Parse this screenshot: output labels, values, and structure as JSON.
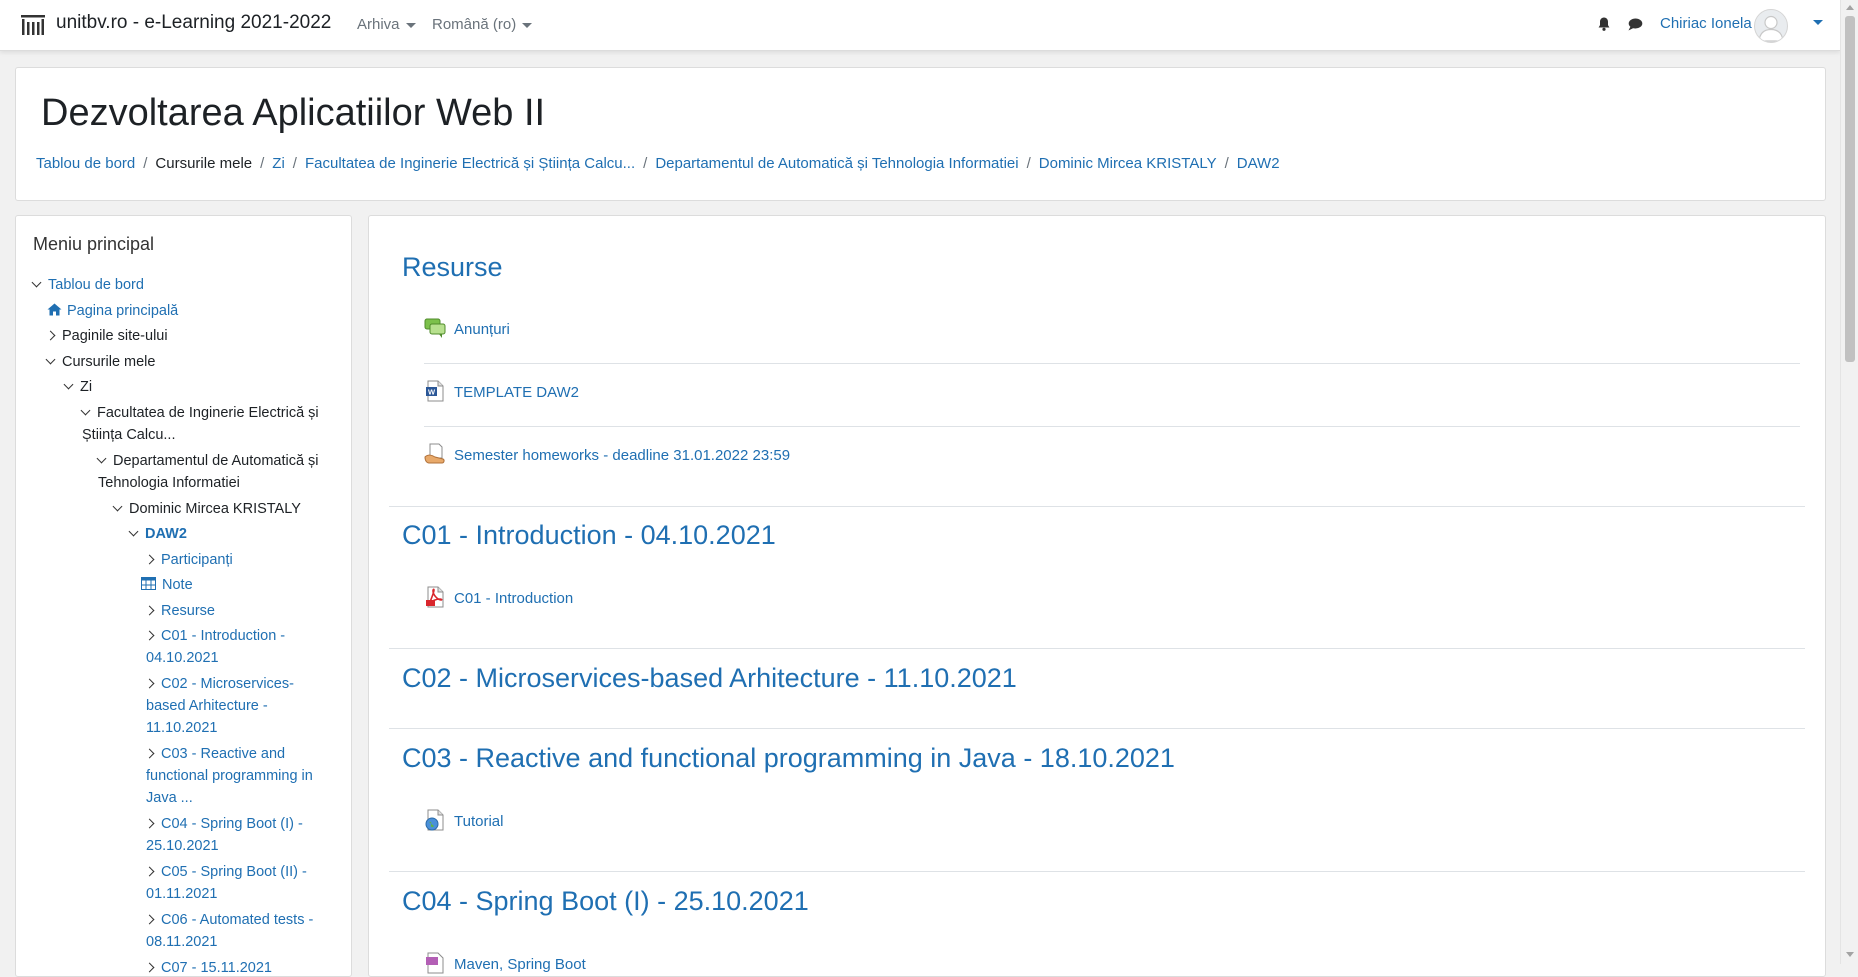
{
  "navbar": {
    "site_title": "unitbv.ro - e-Learning 2021-2022",
    "menu_archive": "Arhiva",
    "menu_language": "Română (ro)",
    "user_name": "Chiriac Ionela",
    "icons": [
      "notifications-bell-icon",
      "messages-icon",
      "user-avatar",
      "user-menu-caret-icon"
    ]
  },
  "header": {
    "title": "Dezvoltarea Aplicatiilor Web II",
    "breadcrumb": [
      "Tablou de bord",
      "Cursurile mele",
      "Zi",
      "Facultatea de Inginerie Electrică și Știința Calcu...",
      "Departamentul de Automatică și Tehnologia Informatiei",
      "Dominic Mircea KRISTALY",
      "DAW2"
    ],
    "separator": "/"
  },
  "sidebar": {
    "title": "Meniu principal",
    "items": [
      "Tablou de bord",
      "Pagina principală",
      "Paginile site-ului",
      "Cursurile mele",
      "Zi",
      "Facultatea de Inginerie Electrică și",
      "Știința Calcu...",
      "Departamentul de Automatică și",
      "Tehnologia Informatiei",
      "Dominic Mircea KRISTALY",
      "DAW2",
      "Participanți",
      "Note",
      "Resurse",
      "C01 - Introduction -",
      "04.10.2021",
      "C02 - Microservices-",
      "based Arhitecture -",
      "11.10.2021",
      "C03 - Reactive and",
      "functional programming in",
      "Java ...",
      "C04 - Spring Boot (I) -",
      "25.10.2021",
      "C05 - Spring Boot (II) -",
      "01.11.2021",
      "C06 - Automated tests -",
      "08.11.2021",
      "C07 - 15.11.2021"
    ]
  },
  "main": {
    "sections": [
      {
        "title": "Resurse",
        "activities": [
          {
            "label": "Anunțuri",
            "icon": "forum-icon"
          },
          {
            "label": "TEMPLATE DAW2",
            "icon": "word-document-icon"
          },
          {
            "label": "Semester homeworks - deadline 31.01.2022 23:59",
            "icon": "assignment-icon"
          }
        ]
      },
      {
        "title": "C01 - Introduction - 04.10.2021",
        "activities": [
          {
            "label": "C01 - Introduction",
            "icon": "pdf-icon"
          }
        ]
      },
      {
        "title": "C02 - Microservices-based Arhitecture - 11.10.2021",
        "activities": []
      },
      {
        "title": "C03 - Reactive and functional programming in Java - 18.10.2021",
        "activities": [
          {
            "label": "Tutorial",
            "icon": "url-globe-icon"
          }
        ]
      },
      {
        "title": "C04 - Spring Boot (I) - 25.10.2021",
        "activities": [
          {
            "label": "Maven, Spring Boot",
            "icon": "file-icon"
          }
        ]
      }
    ]
  },
  "colors": {
    "link": "#1f6fb2",
    "text": "#1d2125",
    "background": "#f1f1f1"
  }
}
